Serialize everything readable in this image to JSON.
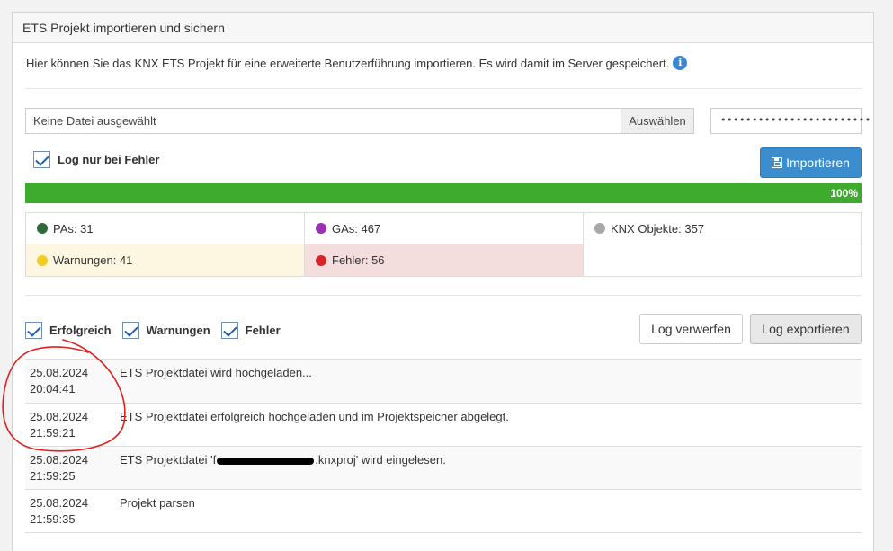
{
  "panel": {
    "title": "ETS Projekt importieren und sichern",
    "description": "Hier können Sie das KNX ETS Projekt für eine erweiterte Benutzerführung importieren. Es wird damit im Server gespeichert.",
    "info_icon": "info-circle-icon"
  },
  "file_input": {
    "value": "Keine Datei ausgewählt",
    "browse_label": "Auswählen"
  },
  "password": {
    "value": "••••••••••••••••••••••••"
  },
  "log_only_errors": {
    "label": "Log nur bei Fehler",
    "checked": true
  },
  "import_button": {
    "label": "Importieren",
    "icon": "save-icon",
    "color": "#3c8dce"
  },
  "progress": {
    "value": 100,
    "label": "100%",
    "color": "#3fab2e"
  },
  "stats": [
    {
      "label": "PAs: 31",
      "dot_color": "#2e6b3a"
    },
    {
      "label": "GAs: 467",
      "dot_color": "#9b2fb5"
    },
    {
      "label": "KNX Objekte: 357",
      "dot_color": "#a8a8a8"
    },
    {
      "label": "Warnungen: 41",
      "dot_color": "#f3cc21"
    },
    {
      "label": "Fehler: 56",
      "dot_color": "#d8232a"
    }
  ],
  "filters": [
    {
      "label": "Erfolgreich",
      "checked": true
    },
    {
      "label": "Warnungen",
      "checked": true
    },
    {
      "label": "Fehler",
      "checked": true
    }
  ],
  "buttons": {
    "discard": "Log verwerfen",
    "export": "Log exportieren"
  },
  "log": [
    {
      "date": "25.08.2024",
      "time": "20:04:41",
      "message": "ETS Projektdatei wird hochgeladen..."
    },
    {
      "date": "25.08.2024",
      "time": "21:59:21",
      "message": "ETS Projektdatei erfolgreich hochgeladen und im Projektspeicher abgelegt."
    },
    {
      "date": "25.08.2024",
      "time": "21:59:25",
      "message_prefix": "ETS Projektdatei 'f",
      "message_suffix": ".knxproj' wird eingelesen."
    },
    {
      "date": "25.08.2024",
      "time": "21:59:35",
      "message": "Projekt parsen"
    }
  ]
}
